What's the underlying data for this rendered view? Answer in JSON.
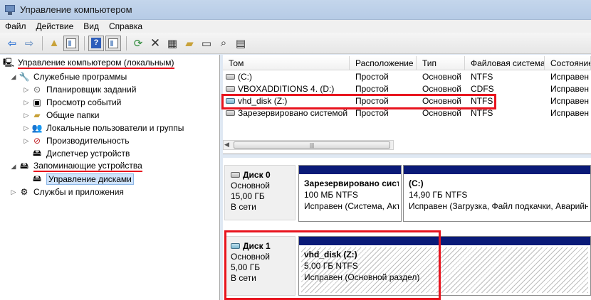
{
  "window": {
    "title": "Управление компьютером"
  },
  "menu": [
    "Файл",
    "Действие",
    "Вид",
    "Справка"
  ],
  "tree": {
    "root": "Управление компьютером (локальным)",
    "system_tools": "Служебные программы",
    "scheduler": "Планировщик заданий",
    "event_viewer": "Просмотр событий",
    "shared_folders": "Общие папки",
    "local_users": "Локальные пользователи и группы",
    "performance": "Производительность",
    "device_manager": "Диспетчер устройств",
    "storage": "Запоминающие устройства",
    "disk_management": "Управление дисками",
    "services": "Службы и приложения"
  },
  "columns": [
    "Том",
    "Расположение",
    "Тип",
    "Файловая система",
    "Состояние"
  ],
  "volumes": [
    {
      "name": "(C:)",
      "layout": "Простой",
      "type": "Основной",
      "fs": "NTFS",
      "status": "Исправен"
    },
    {
      "name": "VBOXADDITIONS 4. (D:)",
      "layout": "Простой",
      "type": "Основной",
      "fs": "CDFS",
      "status": "Исправен"
    },
    {
      "name": "vhd_disk (Z:)",
      "layout": "Простой",
      "type": "Основной",
      "fs": "NTFS",
      "status": "Исправен"
    },
    {
      "name": "Зарезервировано системой",
      "layout": "Простой",
      "type": "Основной",
      "fs": "NTFS",
      "status": "Исправен"
    }
  ],
  "disks": [
    {
      "name": "Диск 0",
      "kind": "Основной",
      "size": "15,00 ГБ",
      "state": "В сети",
      "partitions": [
        {
          "name": "Зарезервировано сист",
          "size": "100 МБ NTFS",
          "status": "Исправен (Система, Акт"
        },
        {
          "name": "(C:)",
          "size": "14,90 ГБ NTFS",
          "status": "Исправен (Загрузка, Файл подкачки, Аварийн"
        }
      ]
    },
    {
      "name": "Диск 1",
      "kind": "Основной",
      "size": "5,00 ГБ",
      "state": "В сети",
      "partitions": [
        {
          "name": "vhd_disk  (Z:)",
          "size": "5,00 ГБ NTFS",
          "status": "Исправен (Основной раздел)"
        }
      ]
    }
  ],
  "colors": {
    "highlight": "#e8141e",
    "partition_bar": "#0a1a78"
  }
}
